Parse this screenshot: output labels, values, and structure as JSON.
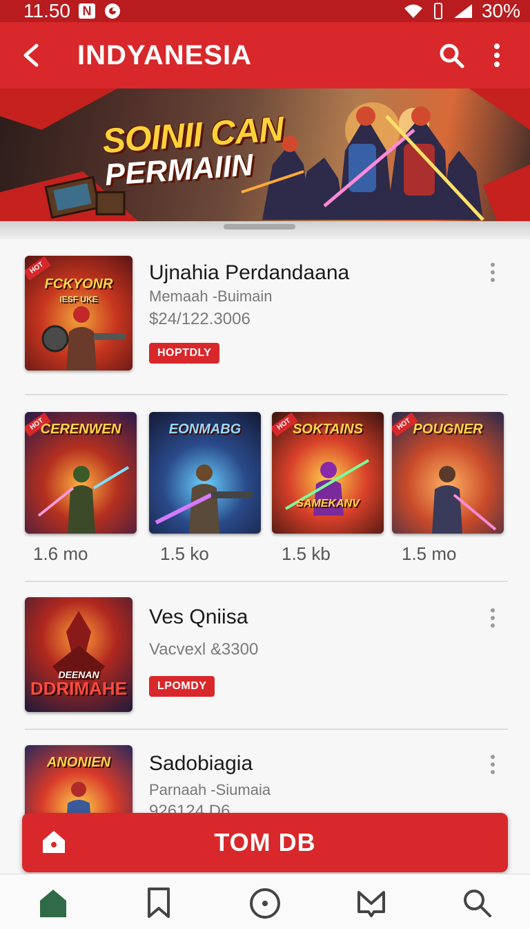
{
  "status": {
    "time": "11.50",
    "battery": "30%"
  },
  "header": {
    "title": "INDYANESIA"
  },
  "banner": {
    "line1": "SOINII CAN",
    "line2": "PERMAIIN"
  },
  "list_top": {
    "title": "Ujnahia Perdandaana",
    "subtitle": "Memaah -Buimain",
    "price": "$24/122.3006",
    "badge": "HOPTDLY",
    "thumb_title": "FCKYONR",
    "thumb_sub": "IESF UKE"
  },
  "grid": [
    {
      "title": "CERENWEN",
      "label": "1.6 mo"
    },
    {
      "title": "EONMABG",
      "label": "1.5 ko"
    },
    {
      "title": "SOKTAINS",
      "mid": "SAMEKANV",
      "label": "1.5 kb"
    },
    {
      "title": "POUGNER",
      "label": "1.5 mo"
    }
  ],
  "list_mid": {
    "title": "Ves Qniisa",
    "price": "Vacvexl &3300",
    "badge": "LPOMDY",
    "thumb_title": "DEENAN",
    "thumb_sub": "DDRIMAHE"
  },
  "list_bottom": {
    "title": "Sadobiagia",
    "subtitle": "Parnaah -Siumaia",
    "price": "926124.D6",
    "thumb_title": "ANONIEN"
  },
  "cta": {
    "label": "TOM DB"
  },
  "colors": {
    "primary": "#d8282b",
    "status": "#b81c1f",
    "nav_active": "#2f6b46"
  },
  "nav": [
    {
      "icon": "home-icon"
    },
    {
      "icon": "bookmark-icon"
    },
    {
      "icon": "circle-icon"
    },
    {
      "icon": "mail-icon"
    },
    {
      "icon": "search-icon"
    }
  ]
}
